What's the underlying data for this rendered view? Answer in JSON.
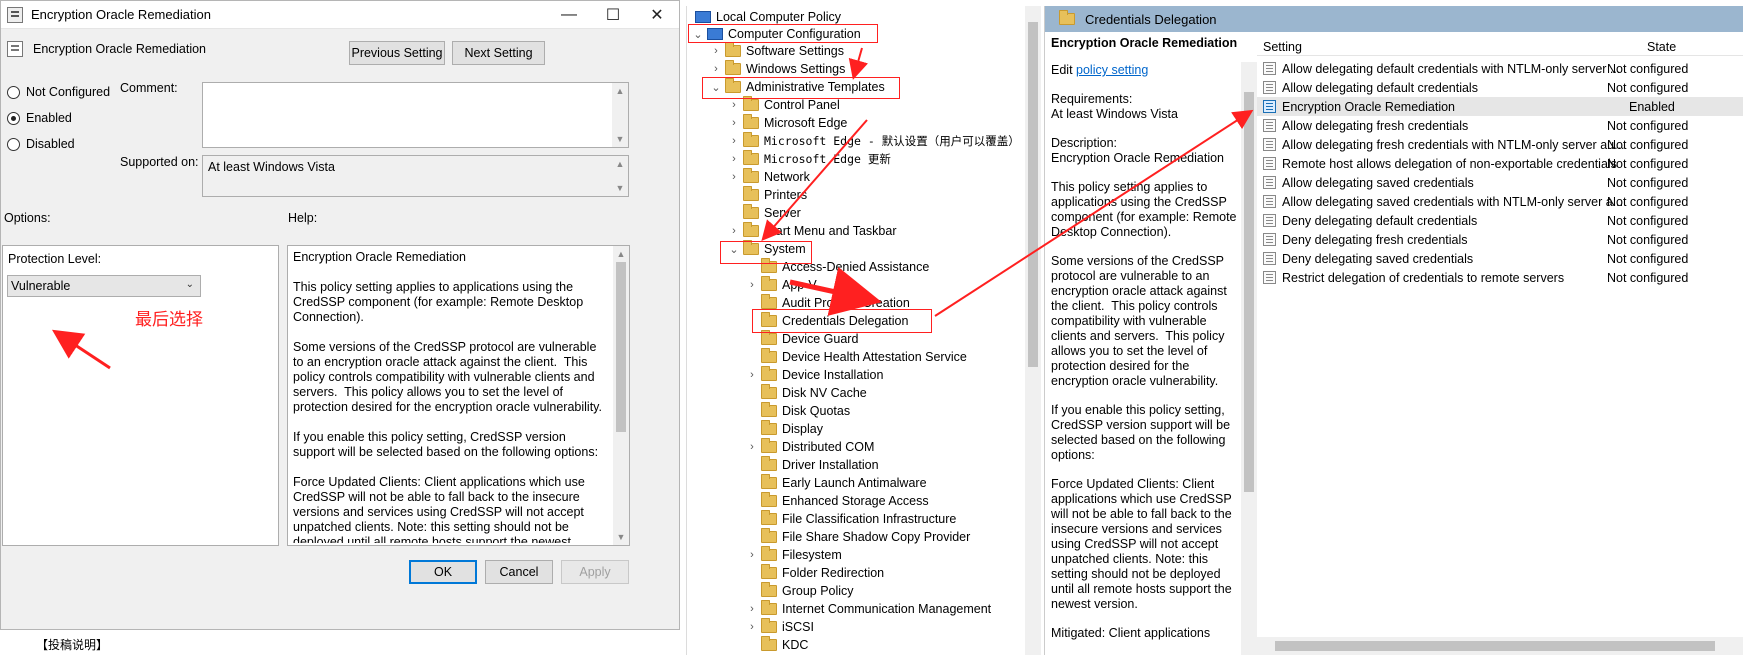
{
  "dialog": {
    "title": "Encryption Oracle Remediation",
    "header_title": "Encryption Oracle Remediation",
    "prev_label": "Previous Setting",
    "next_label": "Next Setting",
    "radio_not_configured": "Not Configured",
    "radio_enabled": "Enabled",
    "radio_disabled": "Disabled",
    "selected_radio": "Enabled",
    "comment_label": "Comment:",
    "comment_value": "",
    "supported_label": "Supported on:",
    "supported_value": "At least Windows Vista",
    "options_label": "Options:",
    "help_label": "Help:",
    "protection_label": "Protection Level:",
    "protection_value": "Vulnerable",
    "help_text": "Encryption Oracle Remediation\n\nThis policy setting applies to applications using the CredSSP component (for example: Remote Desktop Connection).\n\nSome versions of the CredSSP protocol are vulnerable to an encryption oracle attack against the client.  This policy controls compatibility with vulnerable clients and servers.  This policy allows you to set the level of protection desired for the encryption oracle vulnerability.\n\nIf you enable this policy setting, CredSSP version support will be selected based on the following options:\n\nForce Updated Clients: Client applications which use CredSSP will not be able to fall back to the insecure versions and services using CredSSP will not accept unpatched clients. Note: this setting should not be deployed until all remote hosts support the newest version.\n\nMitigated: Client applications which use CredSSP will not be able",
    "ok_label": "OK",
    "cancel_label": "Cancel",
    "apply_label": "Apply",
    "annotation": "最后选择",
    "bottom_note": "【投稿说明】"
  },
  "tree": {
    "root": "Local Computer Policy",
    "computer_config": "Computer Configuration",
    "software_settings": "Software Settings",
    "windows_settings": "Windows Settings",
    "admin_templates": "Administrative Templates",
    "at_children": [
      "Control Panel",
      "Microsoft Edge",
      "Microsoft Edge - 默认设置（用户可以覆盖）",
      "Microsoft Edge 更新",
      "Network",
      "Printers",
      "Server",
      "Start Menu and Taskbar"
    ],
    "system": "System",
    "system_children": [
      "Access-Denied Assistance",
      "App-V",
      "Audit Process Creation",
      "Credentials Delegation",
      "Device Guard",
      "Device Health Attestation Service",
      "Device Installation",
      "Disk NV Cache",
      "Disk Quotas",
      "Display",
      "Distributed COM",
      "Driver Installation",
      "Early Launch Antimalware",
      "Enhanced Storage Access",
      "File Classification Infrastructure",
      "File Share Shadow Copy Provider",
      "Filesystem",
      "Folder Redirection",
      "Group Policy",
      "Internet Communication Management",
      "iSCSI",
      "KDC"
    ]
  },
  "right": {
    "header": "Credentials Delegation",
    "desc_title": "Encryption Oracle Remediation",
    "edit_prefix": "Edit ",
    "edit_link": "policy setting",
    "requirements": "Requirements:\nAt least Windows Vista",
    "description": "Description:\nEncryption Oracle Remediation",
    "p1": "This policy setting applies to applications using the CredSSP component (for example: Remote Desktop Connection).",
    "p2": "Some versions of the CredSSP protocol are vulnerable to an encryption oracle attack against the client.  This policy controls compatibility with vulnerable clients and servers.  This policy allows you to set the level of protection desired for the encryption oracle vulnerability.",
    "p3": "If you enable this policy setting, CredSSP version support will be selected based on the following options:",
    "p4": "Force Updated Clients: Client applications which use CredSSP will not be able to fall back to the insecure versions and services using CredSSP will not accept unpatched clients. Note: this setting should not be deployed until all remote hosts support the newest version.",
    "p5": "Mitigated: Client applications",
    "col_setting": "Setting",
    "col_state": "State",
    "rows": [
      {
        "name": "Allow delegating default credentials with NTLM-only server ...",
        "state": "Not configured"
      },
      {
        "name": "Allow delegating default credentials",
        "state": "Not configured"
      },
      {
        "name": "Encryption Oracle Remediation",
        "state": "Enabled"
      },
      {
        "name": "Allow delegating fresh credentials",
        "state": "Not configured"
      },
      {
        "name": "Allow delegating fresh credentials with NTLM-only server au...",
        "state": "Not configured"
      },
      {
        "name": "Remote host allows delegation of non-exportable credentials",
        "state": "Not configured"
      },
      {
        "name": "Allow delegating saved credentials",
        "state": "Not configured"
      },
      {
        "name": "Allow delegating saved credentials with NTLM-only server a...",
        "state": "Not configured"
      },
      {
        "name": "Deny delegating default credentials",
        "state": "Not configured"
      },
      {
        "name": "Deny delegating fresh credentials",
        "state": "Not configured"
      },
      {
        "name": "Deny delegating saved credentials",
        "state": "Not configured"
      },
      {
        "name": "Restrict delegation of credentials to remote servers",
        "state": "Not configured"
      }
    ]
  },
  "colors": {
    "annotation_red": "#ff2020",
    "header_blue": "#9bb6cf",
    "link_blue": "#0066cc"
  }
}
